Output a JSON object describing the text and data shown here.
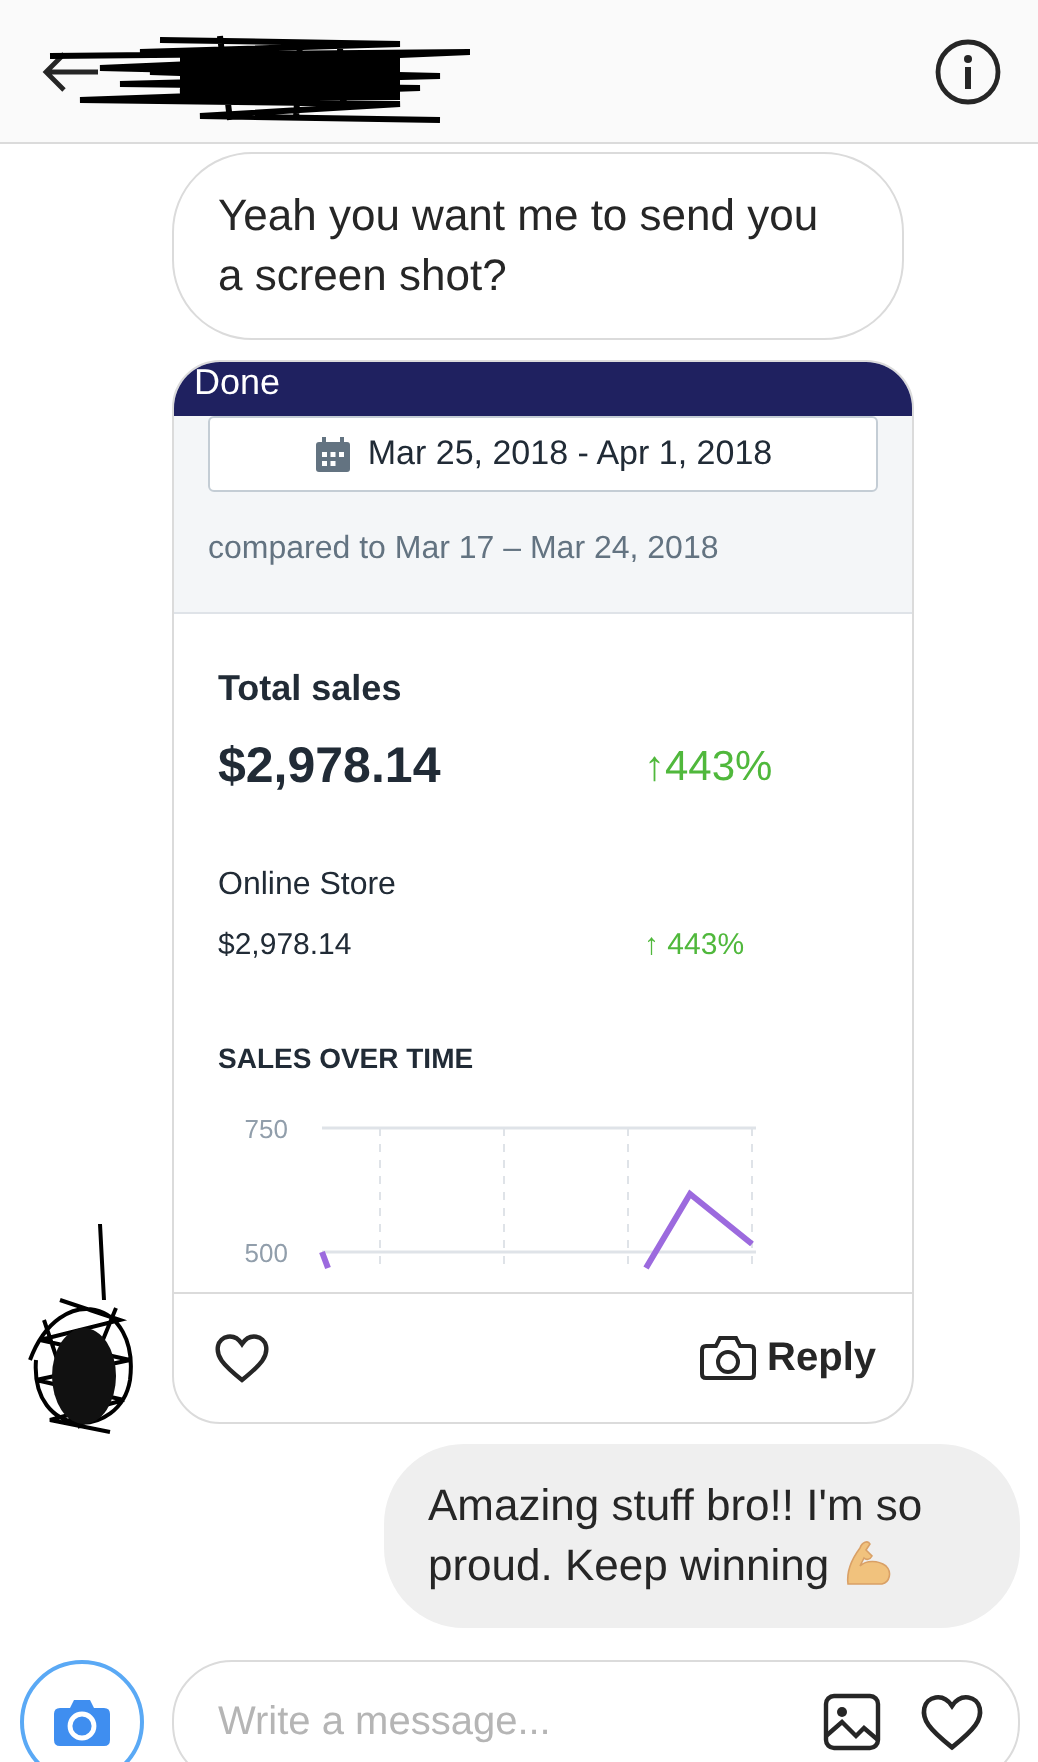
{
  "messages": [
    {
      "kind": "received_text",
      "text": "Yeah you want me to send you a screen shot?"
    },
    {
      "kind": "received_screenshot",
      "action": "Reply",
      "screenshot": {
        "top_button": "Done",
        "date_range": "Mar 25, 2018 - Apr 1, 2018",
        "comparison": "compared to Mar 17 – Mar 24, 2018",
        "total": {
          "label": "Total sales",
          "value": "$2,978.14",
          "change": "↑443%"
        },
        "channels": [
          {
            "name": "Online Store",
            "value": "$2,978.14",
            "change": "↑ 443%"
          }
        ],
        "chart": {
          "title": "SALES OVER TIME",
          "tick_labels": [
            "750",
            "500"
          ]
        }
      }
    },
    {
      "kind": "sent_text",
      "text": "Amazing stuff bro!! I'm so proud. Keep winning"
    }
  ],
  "composer": {
    "placeholder": "Write a message..."
  }
}
